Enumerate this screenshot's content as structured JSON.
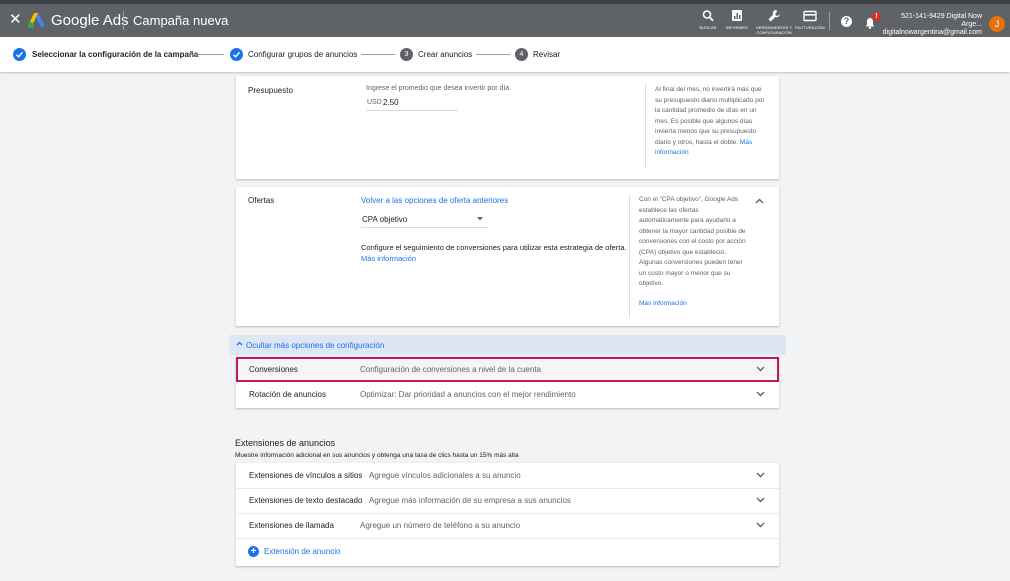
{
  "header": {
    "close_glyph": "✕",
    "brand": "Google Ads",
    "title": "Campaña nueva",
    "tools": [
      {
        "label": "BUSCAR",
        "icon": "search-icon"
      },
      {
        "label": "INFORMES",
        "icon": "reports-icon"
      },
      {
        "label": "HERRAMIENTAS Y CONFIGURACIÓN",
        "icon": "wrench-icon"
      },
      {
        "label": "FACTURACIÓN",
        "icon": "billing-card-icon"
      }
    ],
    "help_glyph": "?",
    "notification_badge": "!",
    "account_id": "521-141-9429 Digital Now Arge...",
    "account_email": "digitalnowargentina@gmail.com",
    "avatar_initial": "J"
  },
  "steps": [
    {
      "label": "Seleccionar la configuración de la campaña",
      "state": "done"
    },
    {
      "label": "Configurar grupos de anuncios",
      "state": "done"
    },
    {
      "label": "Crear anuncios",
      "state": "pending",
      "number": "3"
    },
    {
      "label": "Revisar",
      "state": "pending",
      "number": "4"
    }
  ],
  "budget": {
    "label": "Presupuesto",
    "prompt": "Ingrese el promedio que desea invertir por día",
    "currency": "USD",
    "value": "2.50",
    "help": "Al final del mes, no invertirá más que su presupuesto diario multiplicado por la cantidad promedio de días en un mes. Es posible que algunos días invierta menos que su presupuesto diario y otros, hasta el doble.",
    "help_link": "Más información"
  },
  "bids": {
    "label": "Ofertas",
    "back_link": "Volver a las opciones de oferta anteriores",
    "select_value": "CPA objetivo",
    "note": "Configure el seguimiento de conversiones para utilizar esta estrategia de oferta.",
    "note_link": "Más información",
    "help": "Con el \"CPA objetivo\", Google Ads establece las ofertas automáticamente para ayudarlo a obtener la mayor cantidad posible de conversiones con el costo por acción (CPA) objetivo que estableció. Algunas conversiones pueden tener un costo mayor o menor que su objetivo.",
    "help_link": "Más información"
  },
  "more_options": {
    "toggle_label": "Ocultar más opciones de configuración",
    "rows": [
      {
        "label": "Conversiones",
        "value": "Configuración de conversiones a nivel de la cuenta"
      },
      {
        "label": "Rotación de anuncios",
        "value": "Optimizar: Dar prioridad a anuncios con el mejor rendimiento"
      }
    ]
  },
  "extensions": {
    "title": "Extensiones de anuncios",
    "subtitle": "Muestre información adicional en sus anuncios y obtenga una tasa de clics hasta un 15% más alta",
    "rows": [
      {
        "label": "Extensiones de vínculos a sitios",
        "value": "Agregue vínculos adicionales a su anuncio"
      },
      {
        "label": "Extensiones de texto destacado",
        "value": "Agregue más información de su empresa a sus anuncios"
      },
      {
        "label": "Extensiones de llamada",
        "value": "Agregue un número de teléfono a su anuncio"
      }
    ],
    "add_label": "Extensión de anuncio"
  },
  "colors": {
    "header_bg": "#5f6368",
    "accent_blue": "#1a73e8",
    "highlight_border": "#c2185b",
    "page_bg": "#f1f3f4"
  }
}
